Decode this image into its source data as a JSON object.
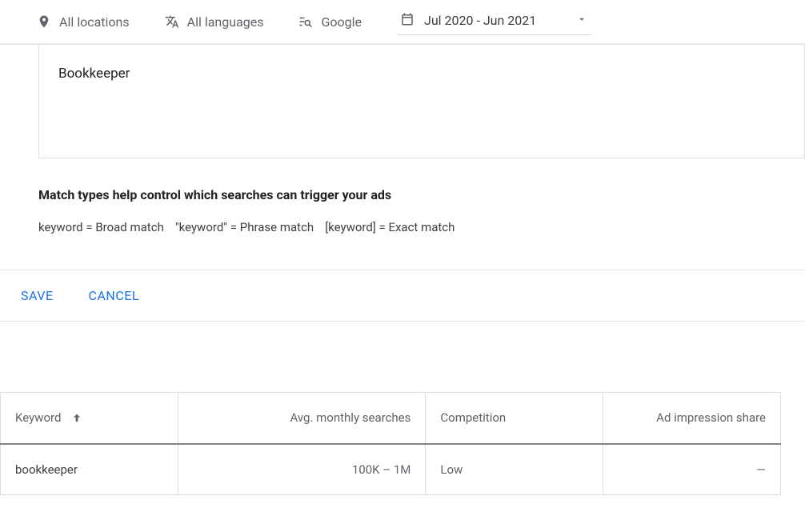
{
  "toolbar": {
    "locations": "All locations",
    "languages": "All languages",
    "network": "Google",
    "dateRange": "Jul 2020 - Jun 2021"
  },
  "input": {
    "value": "Bookkeeper"
  },
  "help": {
    "heading": "Match types help control which searches can trigger your ads",
    "broad": "keyword = Broad match",
    "phrase": "\"keyword\" = Phrase match",
    "exact": "[keyword] = Exact match"
  },
  "actions": {
    "save": "SAVE",
    "cancel": "CANCEL"
  },
  "table": {
    "headers": {
      "keyword": "Keyword",
      "avg": "Avg. monthly searches",
      "competition": "Competition",
      "adshare": "Ad impression share"
    },
    "rows": [
      {
        "keyword": "bookkeeper",
        "avg": "100K – 1M",
        "competition": "Low",
        "adshare": "—"
      }
    ]
  }
}
